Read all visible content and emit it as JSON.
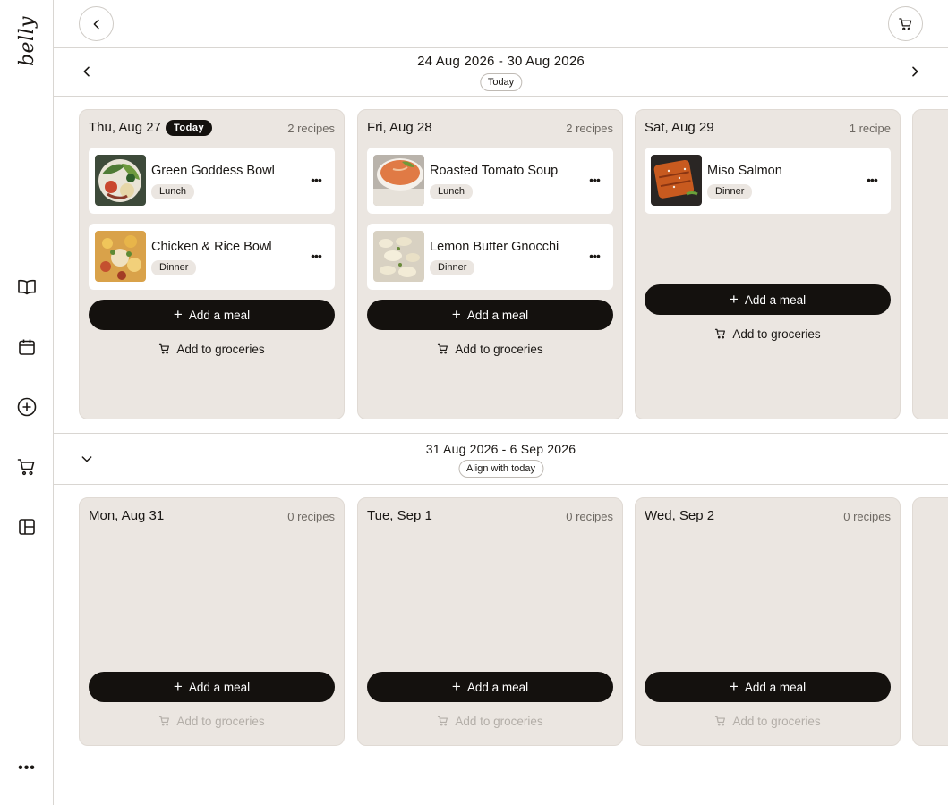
{
  "app": {
    "logo": "belly"
  },
  "sidebar": {
    "items": [
      {
        "name": "recipes",
        "icon": "book-icon"
      },
      {
        "name": "planner",
        "icon": "calendar-icon"
      },
      {
        "name": "add",
        "icon": "plus-circle-icon"
      },
      {
        "name": "groceries",
        "icon": "cart-icon"
      },
      {
        "name": "layout",
        "icon": "layout-icon"
      }
    ],
    "more_label": "•••"
  },
  "weeks": [
    {
      "range": "24 Aug 2026 - 30 Aug 2026",
      "pill": "Today",
      "days": [
        {
          "title": "Thu, Aug 27",
          "badge": "Today",
          "count": "2 recipes",
          "meals": [
            {
              "name": "Green Goddess Bowl",
              "tag": "Lunch",
              "thumb": "salad"
            },
            {
              "name": "Chicken & Rice Bowl",
              "tag": "Dinner",
              "thumb": "rice"
            }
          ],
          "add_label": "Add a meal",
          "groceries_label": "Add to groceries"
        },
        {
          "title": "Fri, Aug 28",
          "count": "2 recipes",
          "meals": [
            {
              "name": "Roasted Tomato Soup",
              "tag": "Lunch",
              "thumb": "soup"
            },
            {
              "name": "Lemon Butter Gnocchi",
              "tag": "Dinner",
              "thumb": "gnocchi"
            }
          ],
          "add_label": "Add a meal",
          "groceries_label": "Add to groceries"
        },
        {
          "title": "Sat, Aug 29",
          "count": "1 recipe",
          "meals": [
            {
              "name": "Miso Salmon",
              "tag": "Dinner",
              "thumb": "salmon"
            }
          ],
          "add_label": "Add a meal",
          "groceries_label": "Add to groceries"
        }
      ]
    },
    {
      "range": "31 Aug 2026 - 6 Sep 2026",
      "pill": "Align with today",
      "days": [
        {
          "title": "Mon, Aug 31",
          "count": "0 recipes",
          "add_label": "Add a meal",
          "groceries_label": "Add to groceries"
        },
        {
          "title": "Tue, Sep 1",
          "count": "0 recipes",
          "add_label": "Add a meal",
          "groceries_label": "Add to groceries"
        },
        {
          "title": "Wed, Sep 2",
          "count": "0 recipes",
          "add_label": "Add a meal",
          "groceries_label": "Add to groceries"
        }
      ]
    }
  ],
  "colors": {
    "card_bg": "#ebe6e1",
    "primary": "#14110e",
    "border": "#d9d6d2",
    "muted_text": "#6e6963",
    "disabled_text": "#b3aea8"
  }
}
